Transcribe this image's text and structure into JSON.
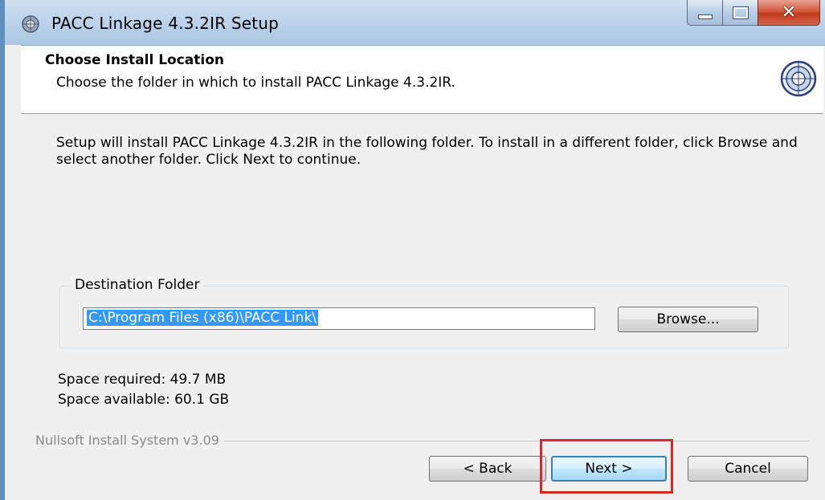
{
  "window": {
    "title": "PACC Linkage 4.3.2IR Setup"
  },
  "header": {
    "title": "Choose Install Location",
    "subtitle": "Choose the folder in which to install PACC Linkage 4.3.2IR."
  },
  "description": "Setup will install PACC Linkage 4.3.2IR in the following folder. To install in a different folder, click Browse and select another folder. Click Next to continue.",
  "destination": {
    "group_label": "Destination Folder",
    "path_value": "C:\\Program Files (x86)\\PACC Link\\",
    "browse_label": "Browse..."
  },
  "space": {
    "required": "Space required: 49.7 MB",
    "available": "Space available: 60.1 GB"
  },
  "footer": {
    "branding": "Nullsoft Install System v3.09",
    "back_label": "< Back",
    "next_label": "Next >",
    "cancel_label": "Cancel"
  },
  "icons": {
    "title_icon": "installer-icon",
    "header_logo": "product-logo-icon"
  },
  "colors": {
    "selection": "#3399ff",
    "highlight_box": "#d42a2a",
    "close_button": "#c13a1d"
  }
}
